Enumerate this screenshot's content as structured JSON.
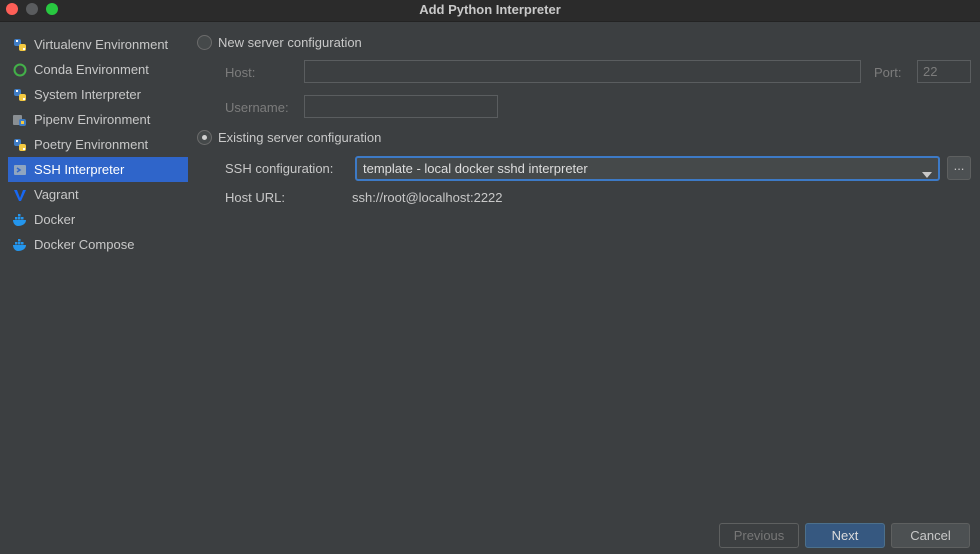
{
  "window": {
    "title": "Add Python Interpreter"
  },
  "sidebar": {
    "items": [
      {
        "label": "Virtualenv Environment",
        "icon": "python-icon",
        "selected": false
      },
      {
        "label": "Conda Environment",
        "icon": "conda-icon",
        "selected": false
      },
      {
        "label": "System Interpreter",
        "icon": "python-icon",
        "selected": false
      },
      {
        "label": "Pipenv Environment",
        "icon": "pipenv-icon",
        "selected": false
      },
      {
        "label": "Poetry Environment",
        "icon": "poetry-icon",
        "selected": false
      },
      {
        "label": "SSH Interpreter",
        "icon": "ssh-icon",
        "selected": true
      },
      {
        "label": "Vagrant",
        "icon": "vagrant-icon",
        "selected": false
      },
      {
        "label": "Docker",
        "icon": "docker-icon",
        "selected": false
      },
      {
        "label": "Docker Compose",
        "icon": "docker-compose-icon",
        "selected": false
      }
    ]
  },
  "new_server": {
    "radio_label": "New server configuration",
    "selected": false,
    "host_label": "Host:",
    "host_value": "",
    "port_label": "Port:",
    "port_value": "22",
    "username_label": "Username:",
    "username_value": ""
  },
  "existing_server": {
    "radio_label": "Existing server configuration",
    "selected": true,
    "ssh_config_label": "SSH configuration:",
    "ssh_config_value": "template - local docker sshd interpreter",
    "browse_label": "...",
    "host_url_label": "Host URL:",
    "host_url_value": "ssh://root@localhost:2222"
  },
  "footer": {
    "previous_label": "Previous",
    "next_label": "Next",
    "cancel_label": "Cancel"
  },
  "colors": {
    "background": "#3c3f41",
    "selection": "#2f65ca",
    "focus_border": "#3d7ac6",
    "primary_button": "#365880"
  }
}
